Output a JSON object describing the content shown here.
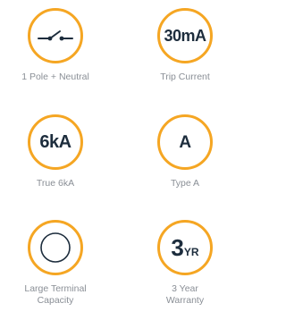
{
  "colors": {
    "ring": "#f5a623",
    "icon_text": "#1d2d3d",
    "caption": "#8a8f96",
    "background": "#ffffff"
  },
  "features": [
    {
      "icon": "switch-icon",
      "caption": "1 Pole + Neutral"
    },
    {
      "icon_text": "30mA",
      "caption": "Trip Current"
    },
    {
      "icon_text": "6kA",
      "caption": "True 6kA"
    },
    {
      "icon_text": "A",
      "caption": "Type A"
    },
    {
      "icon": "terminal-circle-icon",
      "caption_line1": "Large Terminal",
      "caption_line2": "Capacity"
    },
    {
      "icon_text_main": "3",
      "icon_text_sub": "YR",
      "caption_line1": "3 Year",
      "caption_line2": "Warranty"
    }
  ]
}
